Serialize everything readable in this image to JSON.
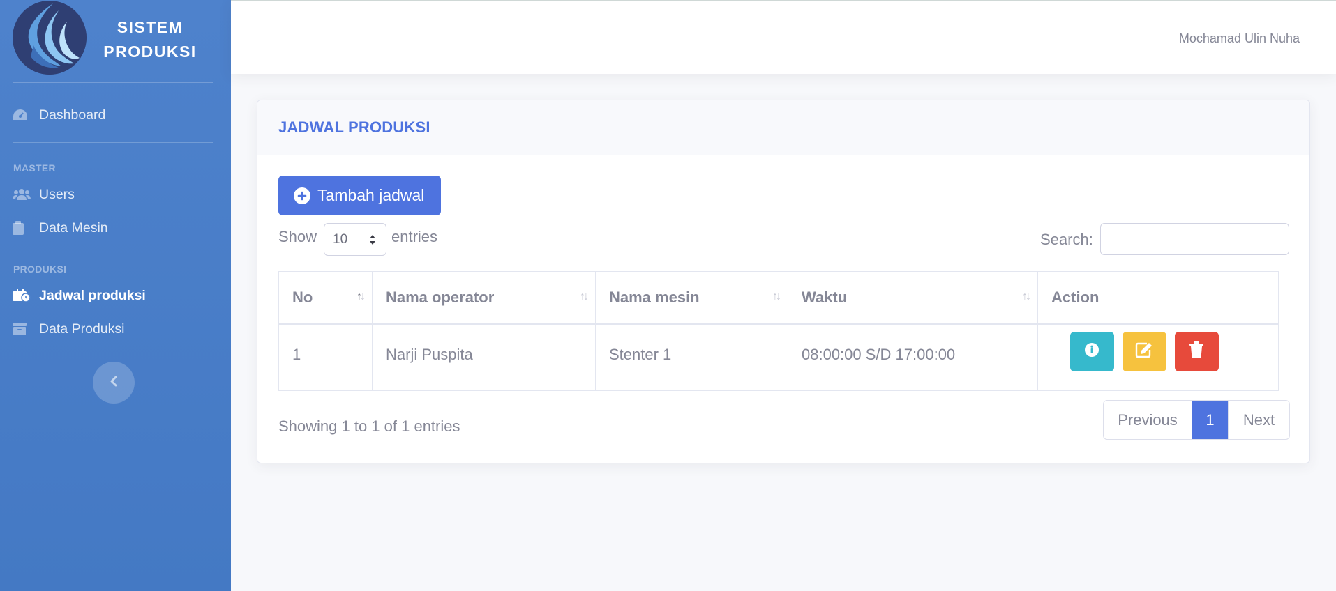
{
  "brand": {
    "line1": "SISTEM",
    "line2": "PRODUKSI"
  },
  "sidebar": {
    "dashboard": "Dashboard",
    "heading_master": "MASTER",
    "users": "Users",
    "data_mesin": "Data Mesin",
    "heading_produksi": "PRODUKSI",
    "jadwal_produksi": "Jadwal produksi",
    "data_produksi": "Data Produksi"
  },
  "topbar": {
    "user_name": "Mochamad Ulin Nuha"
  },
  "card": {
    "title": "JADWAL PRODUKSI",
    "add_button": "Tambah jadwal",
    "show_label": "Show",
    "entries_label": "entries",
    "page_length": "10",
    "search_label": "Search:",
    "search_value": ""
  },
  "table": {
    "headers": {
      "no": "No",
      "operator": "Nama operator",
      "mesin": "Nama mesin",
      "waktu": "Waktu",
      "action": "Action"
    },
    "rows": [
      {
        "no": "1",
        "operator": "Narji Puspita",
        "mesin": "Stenter 1",
        "waktu": "08:00:00 S/D 17:00:00"
      }
    ]
  },
  "footer": {
    "info": "Showing 1 to 1 of 1 entries",
    "previous": "Previous",
    "current_page": "1",
    "next": "Next"
  },
  "colors": {
    "sidebar": "#4e82cc",
    "primary": "#4e73df",
    "info": "#36b9cc",
    "warning": "#f6c23e",
    "danger": "#e74a3b"
  }
}
